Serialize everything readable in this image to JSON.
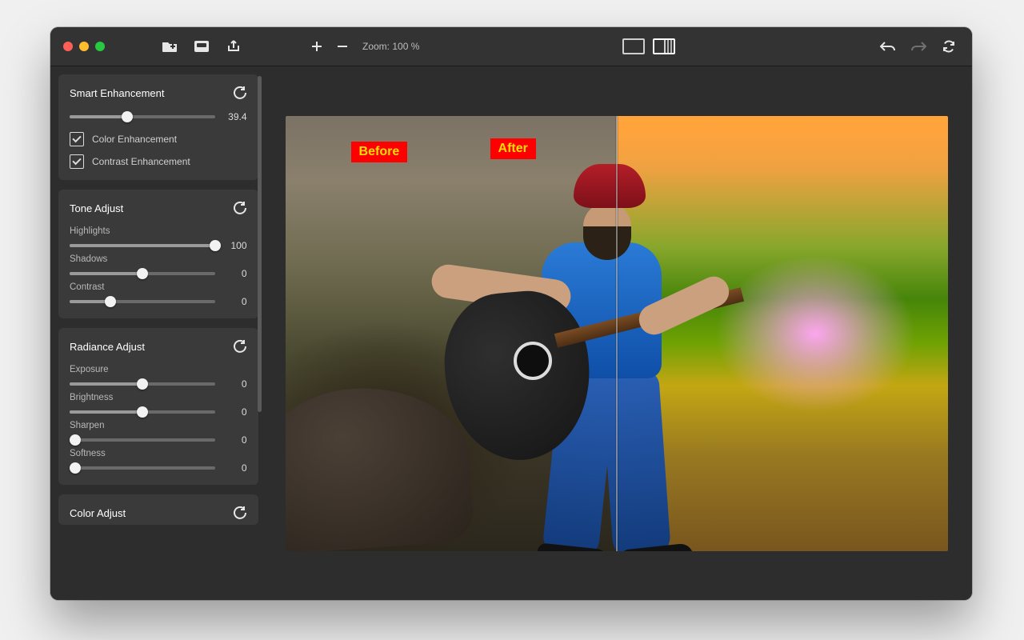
{
  "toolbar": {
    "zoom_label": "Zoom: 100 %"
  },
  "canvas": {
    "before_label": "Before",
    "after_label": "After"
  },
  "panels": {
    "smart": {
      "title": "Smart Enhancement",
      "value": "39.4",
      "pct": 39.4,
      "color_label": "Color Enhancement",
      "contrast_label": "Contrast Enhancement"
    },
    "tone": {
      "title": "Tone Adjust",
      "highlights_label": "Highlights",
      "highlights_value": "100",
      "highlights_pct": 100,
      "shadows_label": "Shadows",
      "shadows_value": "0",
      "shadows_pct": 50,
      "contrast_label": "Contrast",
      "contrast_value": "0",
      "contrast_pct": 28
    },
    "radiance": {
      "title": "Radiance Adjust",
      "exposure_label": "Exposure",
      "exposure_value": "0",
      "exposure_pct": 50,
      "brightness_label": "Brightness",
      "brightness_value": "0",
      "brightness_pct": 50,
      "sharpen_label": "Sharpen",
      "sharpen_value": "0",
      "sharpen_pct": 4,
      "softness_label": "Softness",
      "softness_value": "0",
      "softness_pct": 4
    },
    "color": {
      "title": "Color Adjust"
    }
  }
}
